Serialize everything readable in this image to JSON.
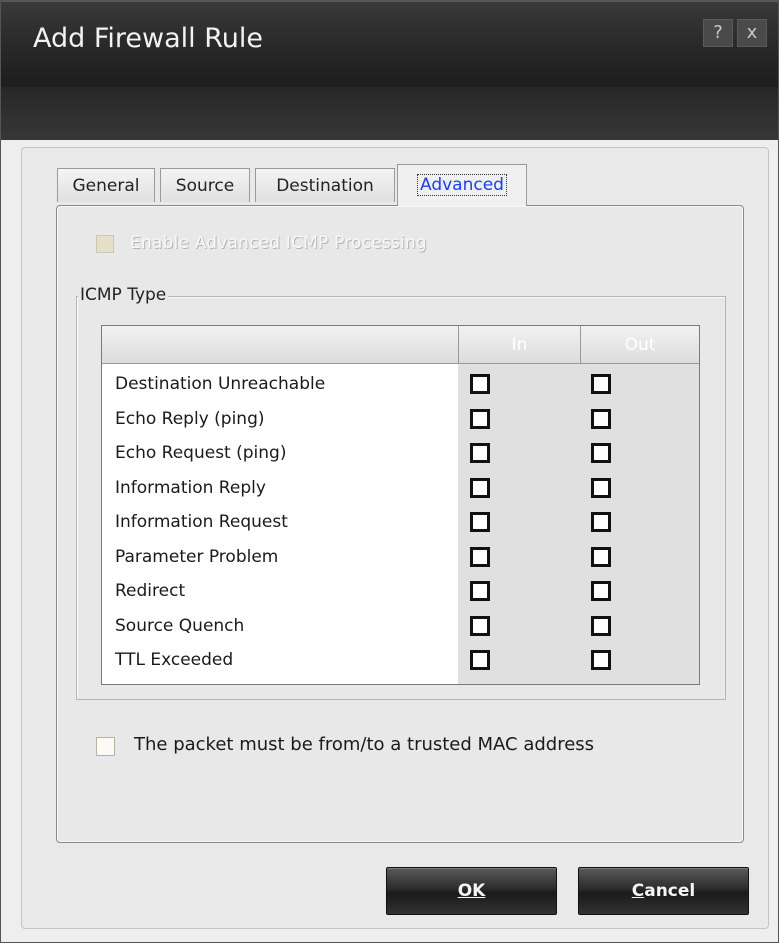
{
  "window": {
    "title": "Add Firewall Rule",
    "help_label": "?",
    "close_label": "x"
  },
  "tabs": [
    {
      "label": "General",
      "active": false
    },
    {
      "label": "Source",
      "active": false
    },
    {
      "label": "Destination",
      "active": false
    },
    {
      "label": "Advanced",
      "active": true
    }
  ],
  "advanced": {
    "enable_icmp_label": "Enable Advanced ICMP Processing",
    "enable_icmp_checked": false,
    "enable_icmp_enabled": false,
    "icmp_group_label": "ICMP Type",
    "columns": {
      "in": "In",
      "out": "Out"
    },
    "icmp_types": [
      {
        "label": "Destination Unreachable",
        "in": false,
        "out": false
      },
      {
        "label": "Echo Reply (ping)",
        "in": false,
        "out": false
      },
      {
        "label": "Echo Request (ping)",
        "in": false,
        "out": false
      },
      {
        "label": "Information Reply",
        "in": false,
        "out": false
      },
      {
        "label": "Information Request",
        "in": false,
        "out": false
      },
      {
        "label": "Parameter Problem",
        "in": false,
        "out": false
      },
      {
        "label": "Redirect",
        "in": false,
        "out": false
      },
      {
        "label": "Source Quench",
        "in": false,
        "out": false
      },
      {
        "label": "TTL Exceeded",
        "in": false,
        "out": false
      }
    ],
    "trusted_mac_label": "The packet must be from/to a trusted MAC address",
    "trusted_mac_checked": false
  },
  "buttons": {
    "ok_label": "OK",
    "cancel_label": "Cancel"
  }
}
